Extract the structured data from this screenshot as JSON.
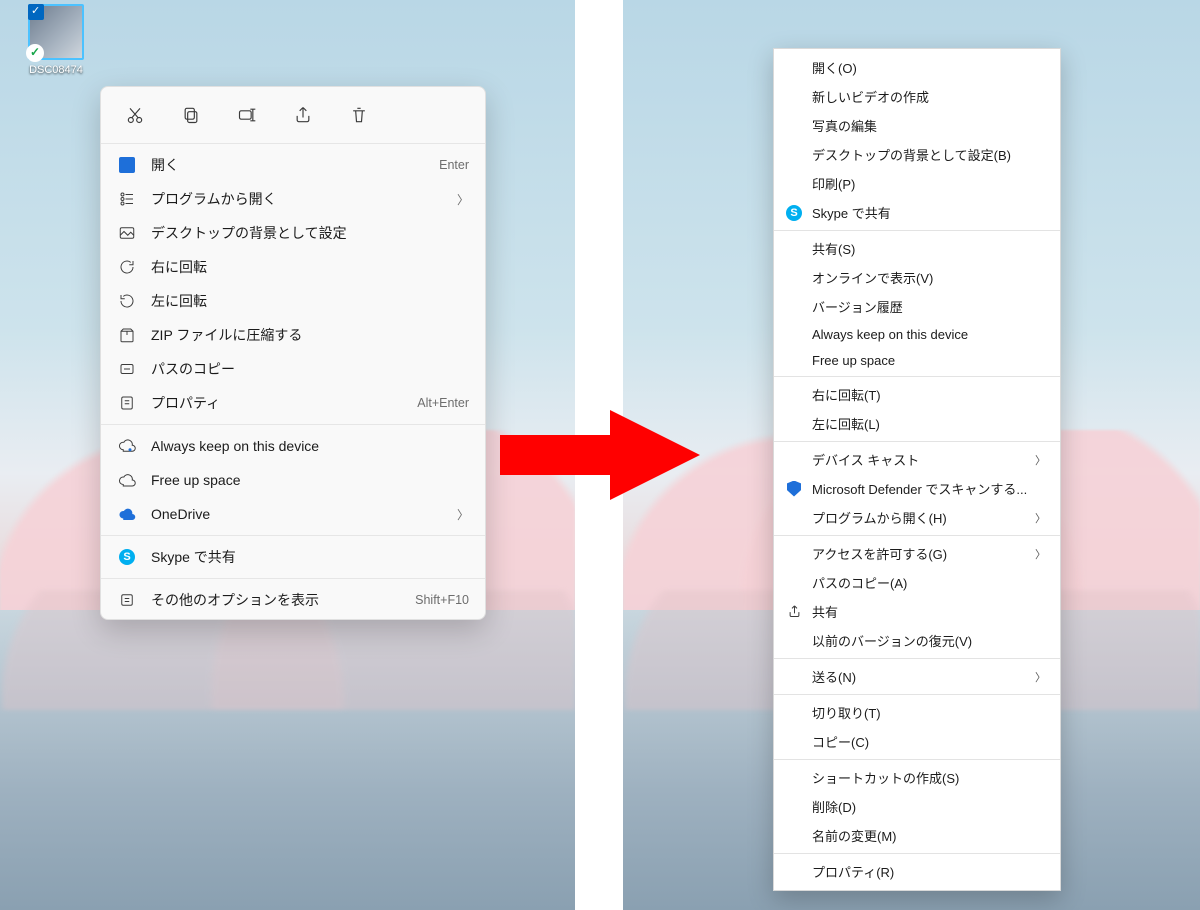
{
  "file": {
    "name": "DSC08474"
  },
  "menu11": {
    "open": {
      "label": "開く",
      "hint": "Enter"
    },
    "openWith": {
      "label": "プログラムから開く"
    },
    "setBg": {
      "label": "デスクトップの背景として設定"
    },
    "rotR": {
      "label": "右に回転"
    },
    "rotL": {
      "label": "左に回転"
    },
    "zip": {
      "label": "ZIP ファイルに圧縮する"
    },
    "copyPath": {
      "label": "パスのコピー"
    },
    "props": {
      "label": "プロパティ",
      "hint": "Alt+Enter"
    },
    "alwaysKeep": {
      "label": "Always keep on this device"
    },
    "freeUp": {
      "label": "Free up space"
    },
    "onedrive": {
      "label": "OneDrive"
    },
    "skype": {
      "label": "Skype で共有"
    },
    "more": {
      "label": "その他のオプションを表示",
      "hint": "Shift+F10"
    }
  },
  "menu10": {
    "open": "開く(O)",
    "newVideo": "新しいビデオの作成",
    "editPhoto": "写真の編集",
    "setBg": "デスクトップの背景として設定(B)",
    "print": "印刷(P)",
    "skype": "Skype で共有",
    "shareS": "共有(S)",
    "viewOnline": "オンラインで表示(V)",
    "verHist": "バージョン履歴",
    "alwaysKeep": "Always keep on this device",
    "freeUp": "Free up space",
    "rotR": "右に回転(T)",
    "rotL": "左に回転(L)",
    "cast": "デバイス キャスト",
    "defender": "Microsoft Defender でスキャンする...",
    "openWith": "プログラムから開く(H)",
    "access": "アクセスを許可する(G)",
    "copyPath": "パスのコピー(A)",
    "share": "共有",
    "restoreVer": "以前のバージョンの復元(V)",
    "sendTo": "送る(N)",
    "cut": "切り取り(T)",
    "copy": "コピー(C)",
    "shortcut": "ショートカットの作成(S)",
    "delete": "削除(D)",
    "rename": "名前の変更(M)",
    "props": "プロパティ(R)"
  }
}
